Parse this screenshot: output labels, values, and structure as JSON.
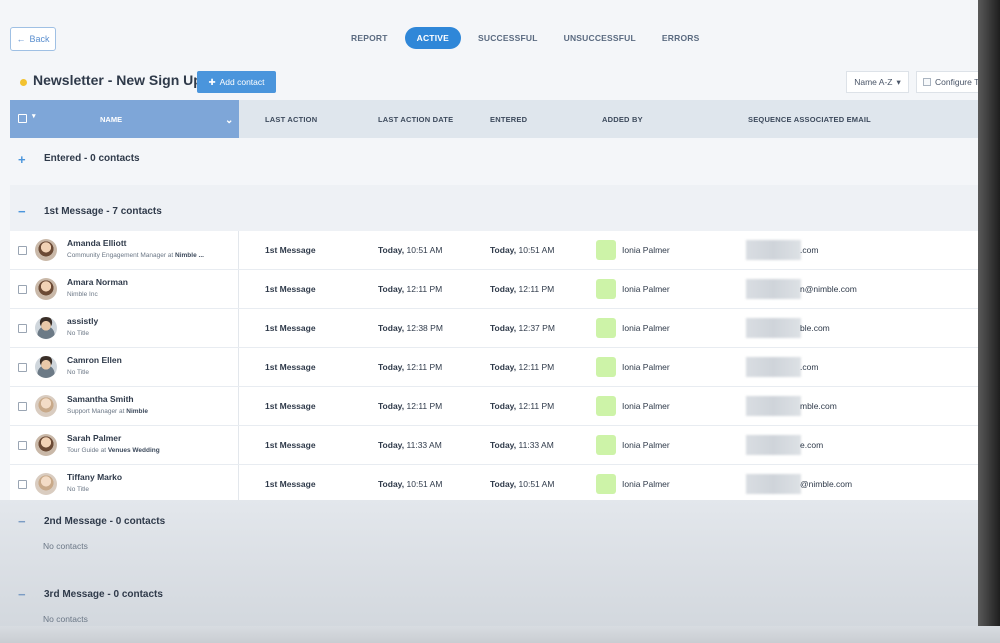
{
  "topbar": {
    "back_label": "Back",
    "tabs": [
      {
        "label": "REPORT"
      },
      {
        "label": "ACTIVE"
      },
      {
        "label": "SUCCESSFUL"
      },
      {
        "label": "UNSUCCESSFUL"
      },
      {
        "label": "ERRORS"
      }
    ]
  },
  "header": {
    "title": "Newsletter - New Sign Ups",
    "add_contact_label": "Add contact",
    "sort_label": "Name A-Z",
    "configure_label": "Configure Ta"
  },
  "table": {
    "columns": {
      "name": "NAME",
      "last_action": "LAST ACTION",
      "last_action_date": "LAST ACTION DATE",
      "entered": "ENTERED",
      "added_by": "ADDED BY",
      "sequence_email": "SEQUENCE ASSOCIATED EMAIL"
    }
  },
  "groups": [
    {
      "label": "Entered - 0 contacts",
      "sign": "+"
    },
    {
      "label": "1st Message - 7 contacts",
      "sign": "−"
    },
    {
      "label": "2nd Message - 0 contacts",
      "sign": "−",
      "empty": "No contacts"
    },
    {
      "label": "3rd Message - 0 contacts",
      "sign": "−",
      "empty": "No contacts"
    }
  ],
  "rows": [
    {
      "name": "Amanda Elliott",
      "title": "Community Engagement Manager at ",
      "company": "Nimble ...",
      "last_action": "1st Message",
      "date_day": "Today,",
      "date_time": "10:51 AM",
      "entered_day": "Today,",
      "entered_time": "10:51 AM",
      "added_by": "Ionia Palmer",
      "email": ".com"
    },
    {
      "name": "Amara Norman",
      "title": "Nimble Inc",
      "company": "",
      "last_action": "1st Message",
      "date_day": "Today,",
      "date_time": "12:11 PM",
      "entered_day": "Today,",
      "entered_time": "12:11 PM",
      "added_by": "Ionia Palmer",
      "email": "n@nimble.com"
    },
    {
      "name": "assistly",
      "title": "No Title",
      "company": "",
      "last_action": "1st Message",
      "date_day": "Today,",
      "date_time": "12:38 PM",
      "entered_day": "Today,",
      "entered_time": "12:37 PM",
      "added_by": "Ionia Palmer",
      "email": "ble.com"
    },
    {
      "name": "Camron Ellen",
      "title": "No Title",
      "company": "",
      "last_action": "1st Message",
      "date_day": "Today,",
      "date_time": "12:11 PM",
      "entered_day": "Today,",
      "entered_time": "12:11 PM",
      "added_by": "Ionia Palmer",
      "email": ".com"
    },
    {
      "name": "Samantha Smith",
      "title": "Support Manager at ",
      "company": "Nimble",
      "last_action": "1st Message",
      "date_day": "Today,",
      "date_time": "12:11 PM",
      "entered_day": "Today,",
      "entered_time": "12:11 PM",
      "added_by": "Ionia Palmer",
      "email": "mble.com"
    },
    {
      "name": "Sarah Palmer",
      "title": "Tour Guide at ",
      "company": "Venues Wedding",
      "last_action": "1st Message",
      "date_day": "Today,",
      "date_time": "11:33 AM",
      "entered_day": "Today,",
      "entered_time": "11:33 AM",
      "added_by": "Ionia Palmer",
      "email": "e.com"
    },
    {
      "name": "Tiffany Marko",
      "title": "No Title",
      "company": "",
      "last_action": "1st Message",
      "date_day": "Today,",
      "date_time": "10:51 AM",
      "entered_day": "Today,",
      "entered_time": "10:51 AM",
      "added_by": "Ionia Palmer",
      "email": "@nimble.com"
    }
  ],
  "colors": {
    "accent": "#2f87d8",
    "header_name_col": "#7ea6d8",
    "status_dot": "#f2c230",
    "added_by_avatar": "#cdf3a8"
  }
}
